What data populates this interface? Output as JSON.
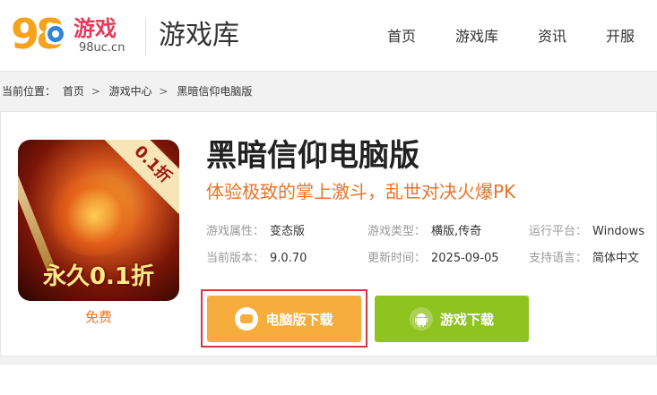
{
  "header": {
    "logo_big": "98",
    "logo_cn": "游戏",
    "logo_url": "98uc.cn",
    "title": "游戏库",
    "nav": [
      "首页",
      "游戏库",
      "资讯",
      "开服"
    ]
  },
  "breadcrumb": {
    "prefix": "当前位置：",
    "items": [
      "首页",
      "游戏中心",
      "黑暗信仰电脑版"
    ],
    "separator": ">"
  },
  "game": {
    "title": "黑暗信仰电脑版",
    "slogan": "体验极致的掌上激斗，乱世对决火爆PK",
    "cover_tag": "0.1折",
    "cover_text": "永久0.1折",
    "price_label": "免费",
    "info": {
      "attr_key": "游戏属性：",
      "attr_val": "变态版",
      "type_key": "游戏类型：",
      "type_val": "横版,传奇",
      "platform_key": "运行平台：",
      "platform_val": "Windows",
      "version_key": "当前版本：",
      "version_val": "9.0.70",
      "updated_key": "更新时间：",
      "updated_val": "2025-09-05",
      "lang_key": "支持语言：",
      "lang_val": "简体中文"
    }
  },
  "buttons": {
    "pc_download": "电脑版下载",
    "game_download": "游戏下载",
    "pc_icon": "gamepad-icon",
    "game_icon": "android-icon"
  },
  "colors": {
    "accent_orange": "#f6ad3e",
    "accent_green": "#8fc31f",
    "slogan": "#e8742a",
    "highlight_frame": "#d9363e"
  }
}
